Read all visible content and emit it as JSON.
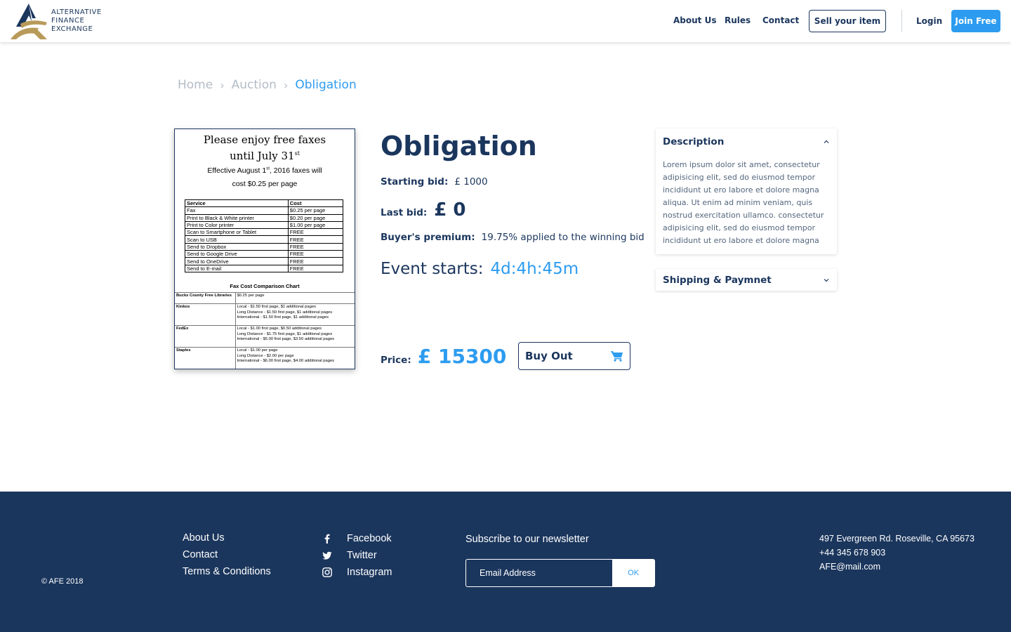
{
  "brand": {
    "logo_lines": [
      "ALTERNATIVE",
      "FINANCE",
      "EXCHANGE"
    ],
    "colors": {
      "navy": "#1b365d",
      "accent": "#2d9cf0",
      "gold": "#b89a5a"
    }
  },
  "nav": {
    "about": "About Us",
    "rules": "Rules",
    "contact": "Contact",
    "sell": "Sell your item",
    "login": "Login",
    "join": "Join Free"
  },
  "breadcrumb": {
    "items": [
      "Home",
      "Auction",
      "Obligation"
    ]
  },
  "document_image": {
    "title_line1": "Please enjoy free faxes",
    "title_line2": "until July 31",
    "title_sup": "st",
    "effective_line1_pre": "Effective August 1",
    "effective_sup": "st",
    "effective_line1_post": ", 2016 faxes will",
    "effective_line2": "cost $0.25 per page",
    "table_headers": [
      "Service",
      "Cost"
    ],
    "table_rows": [
      [
        "Fax",
        "$0.25 per page"
      ],
      [
        "Print to Black & White printer",
        "$0.20 per page"
      ],
      [
        "Print to Color printer",
        "$1.00 per page"
      ],
      [
        "Scan to Smartphone or Tablet",
        "FREE"
      ],
      [
        "Scan to USB",
        "FREE"
      ],
      [
        "Send to Dropbox",
        "FREE"
      ],
      [
        "Send to Google Drive",
        "FREE"
      ],
      [
        "Send to OneDrive",
        "FREE"
      ],
      [
        "Send to E-mail",
        "FREE"
      ]
    ],
    "comparison_title": "Fax Cost Comparison Chart",
    "comparison_rows": [
      {
        "name": "Bucks County Free Libraries",
        "lines": [
          "$0.25 per page"
        ]
      },
      {
        "name": "Kinkos",
        "lines": [
          "Local - $1.50 first page, $1 additional pages",
          "Long Distance - $1.50 first page, $1 additional pages",
          "International - $1.50 first page, $1 additional pages"
        ]
      },
      {
        "name": "FedEx",
        "lines": [
          "Local - $1.00 first page, $0.50 additional pages",
          "Long Distance - $1.75 first page, $1 additional pages",
          "International - $5.00 first page, $3.50 additional pages"
        ]
      },
      {
        "name": "Staples",
        "lines": [
          "Local - $1.00 per page",
          "Long Distance - $2.00 per page",
          "International - $6.00 first page, $4.00 additional pages"
        ]
      }
    ]
  },
  "product": {
    "title": "Obligation",
    "starting_bid_label": "Starting bid:",
    "starting_bid_value": "£ 1000",
    "last_bid_label": "Last bid:",
    "last_bid_value": "£ 0",
    "premium_label": "Buyer's premium:",
    "premium_value": "19.75% applied to the winning bid",
    "event_label": "Event starts:",
    "event_value": "4d:4h:45m",
    "price_label": "Price:",
    "price_value": "£ 15300",
    "buyout_label": "Buy Out"
  },
  "accordion": {
    "description_title": "Description",
    "description_lines": [
      "Lorem ipsum dolor sit amet, consectetur",
      "adipisicing elit, sed do eiusmod tempor",
      "incididunt ut ero labore et dolore magna",
      "aliqua. Ut enim ad minim veniam, quis",
      "nostrud exercitation ullamco. consectetur",
      "adipisicing elit, sed do eiusmod tempor",
      "incididunt ut ero labore et dolore magna"
    ],
    "shipping_title": "Shipping & Paymnet"
  },
  "footer": {
    "copyright": "© AFE 2018",
    "links": [
      "About Us",
      "Contact",
      "Terms & Conditions"
    ],
    "social": [
      {
        "label": "Facebook",
        "icon": "facebook-icon"
      },
      {
        "label": "Twitter",
        "icon": "twitter-icon"
      },
      {
        "label": "Instagram",
        "icon": "instagram-icon"
      }
    ],
    "newsletter_title": "Subscribe to our newsletter",
    "email_placeholder": "Email Address",
    "ok_label": "OK",
    "address": "497 Evergreen Rd. Roseville, CA 95673",
    "phone": "+44 345 678 903",
    "email": "AFE@mail.com"
  }
}
